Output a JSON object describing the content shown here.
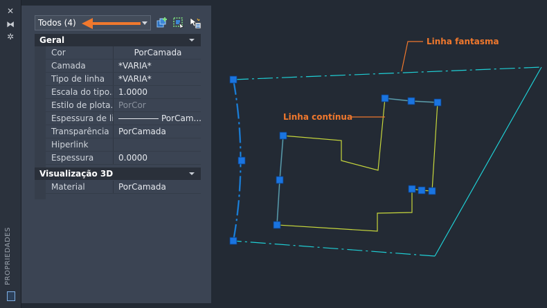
{
  "palette": {
    "tab": "PROPRIEDADES",
    "strip_icons": [
      "close-icon",
      "auto-hide-icon",
      "settings-icon",
      "properties-icon"
    ]
  },
  "selector": {
    "value": "Todos (4)"
  },
  "toolbar": {
    "icons": [
      "toggle-pickadd-icon",
      "select-objects-icon",
      "quick-select-icon"
    ]
  },
  "sections": {
    "general": {
      "title": "Geral",
      "rows": [
        {
          "label": "Cor",
          "value": "PorCamada"
        },
        {
          "label": "Camada",
          "value": "*VARIA*"
        },
        {
          "label": "Tipo de linha",
          "value": "*VARIA*"
        },
        {
          "label": "Escala do tipo...",
          "value": "1.0000"
        },
        {
          "label": "Estilo de plota...",
          "value": "PorCor"
        },
        {
          "label": "Espessura de li...",
          "value": "PorCam..."
        },
        {
          "label": "Transparência",
          "value": "PorCamada"
        },
        {
          "label": "Hiperlink",
          "value": ""
        },
        {
          "label": "Espessura",
          "value": "0.0000"
        }
      ]
    },
    "viz3d": {
      "title": "Visualização 3D",
      "rows": [
        {
          "label": "Material",
          "value": "PorCamada"
        }
      ]
    }
  },
  "drawing": {
    "callout_phantom": "Linha fantasma",
    "callout_continuous": "Linha contínua",
    "colors": {
      "phantom": "#1fd0d6",
      "continuous": "#c8d83c",
      "grip": "#1a74e0",
      "callout": "#f0782d"
    }
  }
}
